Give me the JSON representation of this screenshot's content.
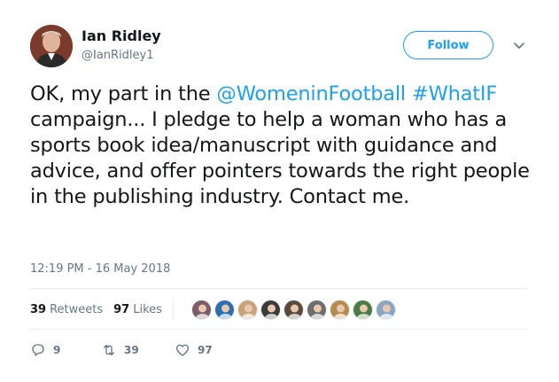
{
  "author": {
    "name": "Ian Ridley",
    "handle": "@IanRidley1"
  },
  "follow_label": "Follow",
  "tweet": {
    "segments": [
      {
        "text": "OK, my part in the ",
        "link": false
      },
      {
        "text": "@WomeninFootball",
        "link": true
      },
      {
        "text": " ",
        "link": false
      },
      {
        "text": "#WhatIF",
        "link": true
      },
      {
        "text": " campaign... I pledge to help a woman who has a sports book idea/manuscript with guidance and advice, and offer pointers towards the right people in the publishing industry. Contact me.",
        "link": false
      }
    ]
  },
  "timestamp": "12:19 PM - 16 May 2018",
  "stats": {
    "retweets": "39",
    "retweets_label": "Retweets",
    "likes": "97",
    "likes_label": "Likes"
  },
  "likers": [
    {
      "icon": "liker-avatar",
      "color": "#7a5d6b"
    },
    {
      "icon": "liker-avatar",
      "color": "#2f6fb0"
    },
    {
      "icon": "liker-avatar",
      "color": "#caa37a"
    },
    {
      "icon": "liker-avatar",
      "color": "#3b3b3b"
    },
    {
      "icon": "liker-avatar",
      "color": "#5a4a3c"
    },
    {
      "icon": "liker-avatar",
      "color": "#6d6d6d"
    },
    {
      "icon": "liker-avatar",
      "color": "#b38d4e"
    },
    {
      "icon": "liker-avatar",
      "color": "#4c7a45"
    },
    {
      "icon": "liker-avatar",
      "color": "#8aa6c1"
    }
  ],
  "actions": {
    "replies": "9",
    "retweets": "39",
    "likes": "97"
  },
  "colors": {
    "accent": "#1da1f2",
    "muted": "#657786",
    "text": "#14171a"
  }
}
